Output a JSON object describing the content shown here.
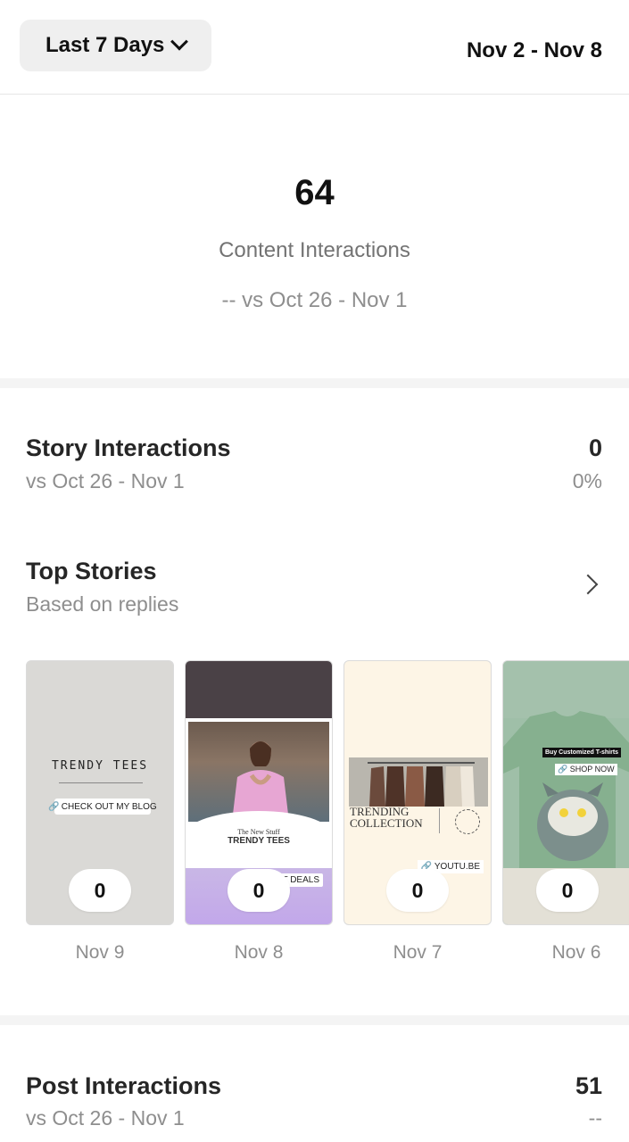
{
  "header": {
    "range_label": "Last 7 Days",
    "date_range": "Nov 2 - Nov 8"
  },
  "overview": {
    "value": "64",
    "label": "Content Interactions",
    "compare": "-- vs Oct 26 - Nov 1"
  },
  "story_interactions": {
    "title": "Story Interactions",
    "subtitle": "vs Oct 26 - Nov 1",
    "value": "0",
    "change": "0%"
  },
  "top_stories": {
    "title": "Top Stories",
    "subtitle": "Based on replies",
    "cards": [
      {
        "count": "0",
        "date": "Nov 9",
        "texts": {
          "title": "TRENDY TEES",
          "link": "CHECK OUT MY BLOG"
        }
      },
      {
        "count": "0",
        "date": "Nov 8",
        "texts": {
          "small": "The New Stuff",
          "title": "TRENDY TEES",
          "tag": "AT DEALS"
        }
      },
      {
        "count": "0",
        "date": "Nov 7",
        "texts": {
          "title": "TRENDING COLLECTION",
          "link": "YOUTU.BE"
        }
      },
      {
        "count": "0",
        "date": "Nov 6",
        "texts": {
          "banner": "Buy Customized T-shirts",
          "link": "SHOP NOW"
        }
      }
    ]
  },
  "post_interactions": {
    "title": "Post Interactions",
    "subtitle": "vs Oct 26 - Nov 1",
    "value": "51",
    "change": "--"
  },
  "colors": {
    "separator": "#f4f4f4",
    "muted_text": "#8e8e8e",
    "pill_bg": "#efefef"
  }
}
